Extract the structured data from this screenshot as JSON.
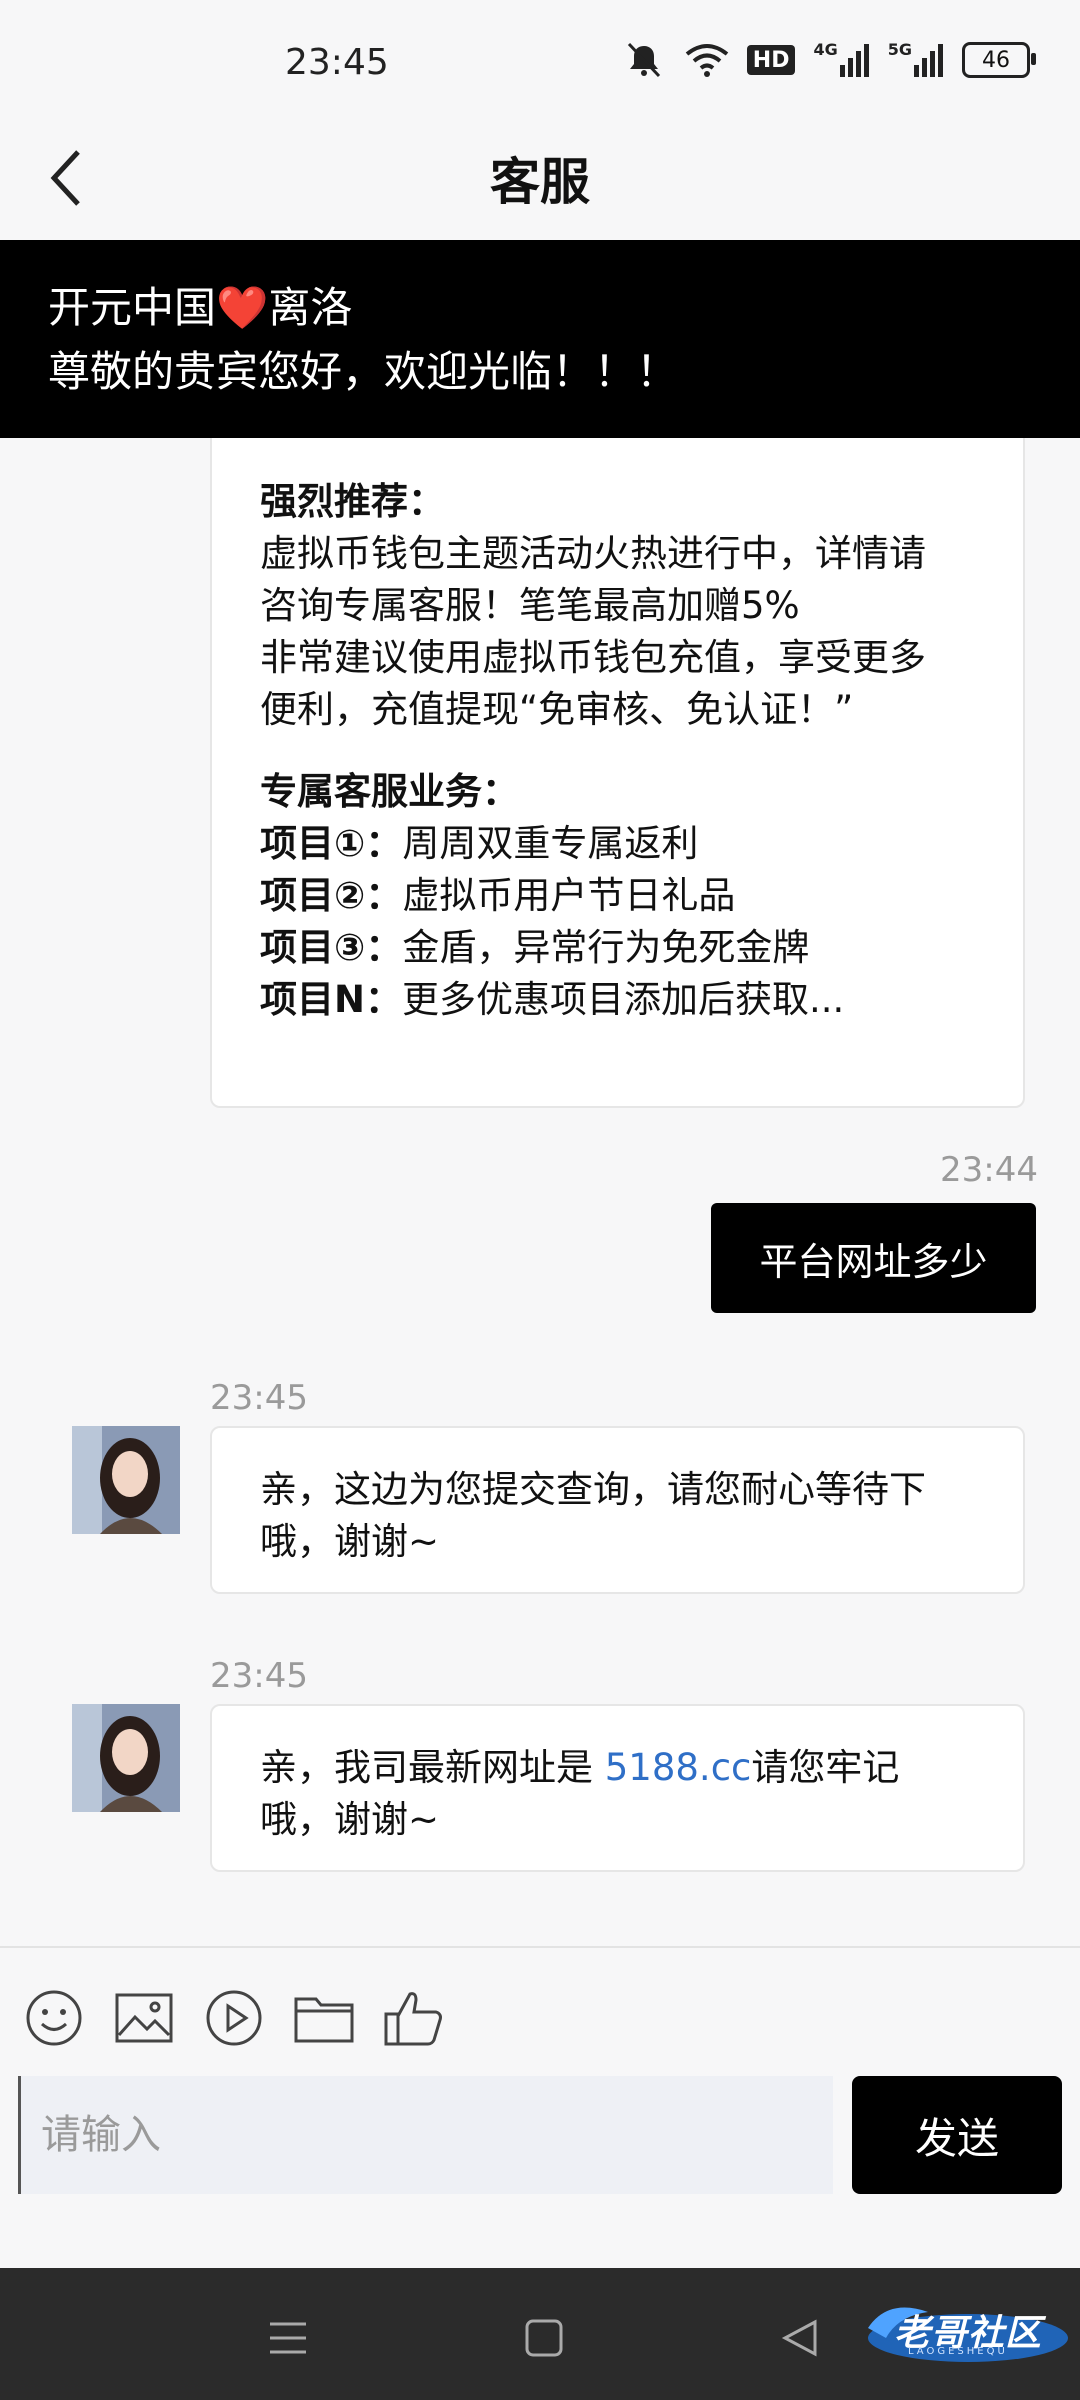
{
  "status_bar": {
    "time": "23:45",
    "battery": "46",
    "hd_label": "HD",
    "net1": "4G",
    "net2": "5G"
  },
  "header": {
    "title": "客服"
  },
  "banner": {
    "line1_a": "开元中国",
    "line1_heart": "❤️",
    "line1_b": "离洛",
    "line2": "尊敬的贵宾您好，欢迎光临！！！"
  },
  "messages": {
    "promo": {
      "heading1": "强烈推荐：",
      "line1": "虚拟币钱包主题活动火热进行中，详情请",
      "line2": "咨询专属客服！笔笔最高加赠5%",
      "line3": "非常建议使用虚拟币钱包充值，享受更多",
      "line4": "便利，充值提现“免审核、免认证！”",
      "heading2": "专属客服业务：",
      "items": [
        {
          "label": "项目①：",
          "text": "周周双重专属返利"
        },
        {
          "label": "项目②：",
          "text": "虚拟币用户节日礼品"
        },
        {
          "label": "项目③：",
          "text": "金盾，异常行为免死金牌"
        },
        {
          "label": "项目N：",
          "text": "更多优惠项目添加后获取..."
        }
      ]
    },
    "user_msg": {
      "time": "23:44",
      "text": "平台网址多少"
    },
    "reply1": {
      "time": "23:45",
      "line1": "亲，这边为您提交查询，请您耐心等待下",
      "line2": "哦，谢谢~"
    },
    "reply2": {
      "time": "23:45",
      "prefix": "亲，我司最新网址是 ",
      "link": "5188.cc",
      "suffix": "请您牢记",
      "line2": "哦，谢谢~"
    }
  },
  "composer": {
    "placeholder": "请输入",
    "send_label": "发送"
  },
  "watermark": {
    "text": "老哥社区",
    "sub": "LAOGESHEQU"
  },
  "colors": {
    "accent": "#000000",
    "link": "#2f6fc7",
    "background": "#f7f7f8"
  }
}
